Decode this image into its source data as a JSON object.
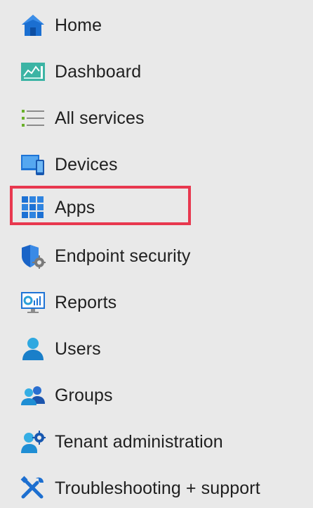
{
  "nav": {
    "items": [
      {
        "id": "home",
        "label": "Home",
        "icon": "home-icon"
      },
      {
        "id": "dashboard",
        "label": "Dashboard",
        "icon": "dashboard-icon"
      },
      {
        "id": "all-services",
        "label": "All services",
        "icon": "list-icon"
      },
      {
        "id": "devices",
        "label": "Devices",
        "icon": "devices-icon"
      },
      {
        "id": "apps",
        "label": "Apps",
        "icon": "apps-grid-icon"
      },
      {
        "id": "endpoint-security",
        "label": "Endpoint security",
        "icon": "shield-gear-icon"
      },
      {
        "id": "reports",
        "label": "Reports",
        "icon": "reports-monitor-icon"
      },
      {
        "id": "users",
        "label": "Users",
        "icon": "user-icon"
      },
      {
        "id": "groups",
        "label": "Groups",
        "icon": "group-icon"
      },
      {
        "id": "tenant-administration",
        "label": "Tenant administration",
        "icon": "tenant-admin-icon"
      },
      {
        "id": "troubleshooting-support",
        "label": "Troubleshooting + support",
        "icon": "wrench-screwdriver-icon"
      }
    ],
    "highlighted_item": "Apps",
    "highlight_color": "#e8384f"
  }
}
